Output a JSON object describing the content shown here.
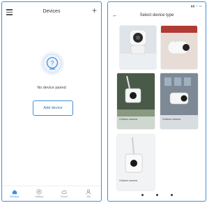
{
  "left_screen": {
    "header": {
      "title": "Devices",
      "menu_icon": "menu-icon",
      "add_icon": "plus-icon"
    },
    "empty_state": {
      "icon": "camera-question-icon",
      "message": "No device paired",
      "button_label": "Add device"
    },
    "tabbar": [
      {
        "label": "Devices",
        "icon": "home-icon",
        "active": true
      },
      {
        "label": "Gallery",
        "icon": "gallery-icon",
        "active": false
      },
      {
        "label": "Cloud",
        "icon": "cloud-icon",
        "active": false
      },
      {
        "label": "Me",
        "icon": "user-icon",
        "active": false
      }
    ],
    "accent_color": "#3f8ed8"
  },
  "right_screen": {
    "header": {
      "title": "Select device type",
      "back_icon": "back-arrow-icon"
    },
    "devices": [
      {
        "name": "",
        "tag": ""
      },
      {
        "name": "",
        "tag": ""
      },
      {
        "name": "Outdoor camera",
        "tag": ""
      },
      {
        "name": "Outdoor camera",
        "tag": ""
      },
      {
        "name": "Outdoor camera",
        "tag": ""
      }
    ]
  }
}
